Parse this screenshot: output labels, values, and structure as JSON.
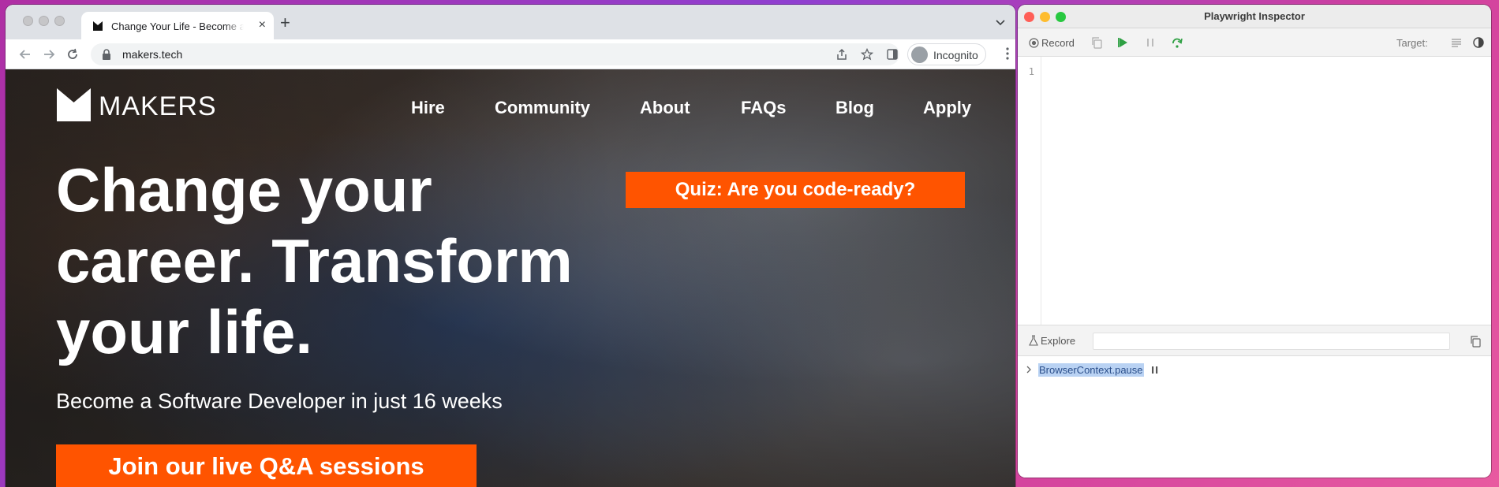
{
  "browser": {
    "tab": {
      "title": "Change Your Life - Become a S",
      "close": "×"
    },
    "new_tab": "+",
    "url": "makers.tech",
    "profile": "Incognito"
  },
  "site": {
    "logo_text": "MAKERS",
    "nav": [
      "Hire",
      "Community",
      "About",
      "FAQs",
      "Blog",
      "Apply"
    ],
    "quiz_button": "Quiz: Are you code-ready?",
    "hero_lines": [
      "Change your",
      "career. Transform",
      "your life."
    ],
    "subtitle": "Become a Software Developer in just 16 weeks",
    "cta_button": "Join our live Q&A sessions",
    "accent": "#ff5400"
  },
  "inspector": {
    "title": "Playwright Inspector",
    "record_label": "Record",
    "target_label": "Target:",
    "line_number": "1",
    "explore_label": "Explore",
    "log_entry": "BrowserContext.pause",
    "colors": {
      "play": "#2ea043",
      "selection": "#b9d2f3"
    }
  }
}
